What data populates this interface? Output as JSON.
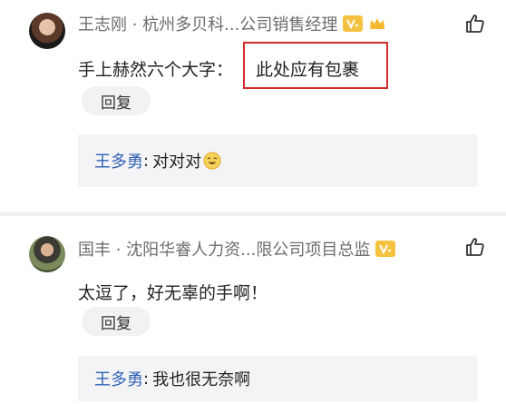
{
  "comments": [
    {
      "author": "王志刚 · 杭州多贝科...公司销售经理",
      "badge_icon": "v-badge-icon",
      "crown_icon": "crown-icon",
      "text": "手上赫然六个大字：",
      "highlight": "此处应有包裹",
      "reply_label": "回复",
      "reply": {
        "author": "王多勇",
        "separator": ":",
        "text": "对对对",
        "emoji": "grinning-emoji"
      }
    },
    {
      "author": "国丰 · 沈阳华睿人力资...限公司项目总监",
      "badge_icon": "v-badge-icon",
      "text": "太逗了，好无辜的手啊！",
      "reply_label": "回复",
      "reply": {
        "author": "王多勇",
        "separator": ":",
        "text": "我也很无奈啊"
      }
    }
  ],
  "colors": {
    "badge": "#f5c23f",
    "reply_author": "#2f62b4",
    "highlight_border": "#d22c2c"
  },
  "like_icon": "thumbs-up-icon"
}
